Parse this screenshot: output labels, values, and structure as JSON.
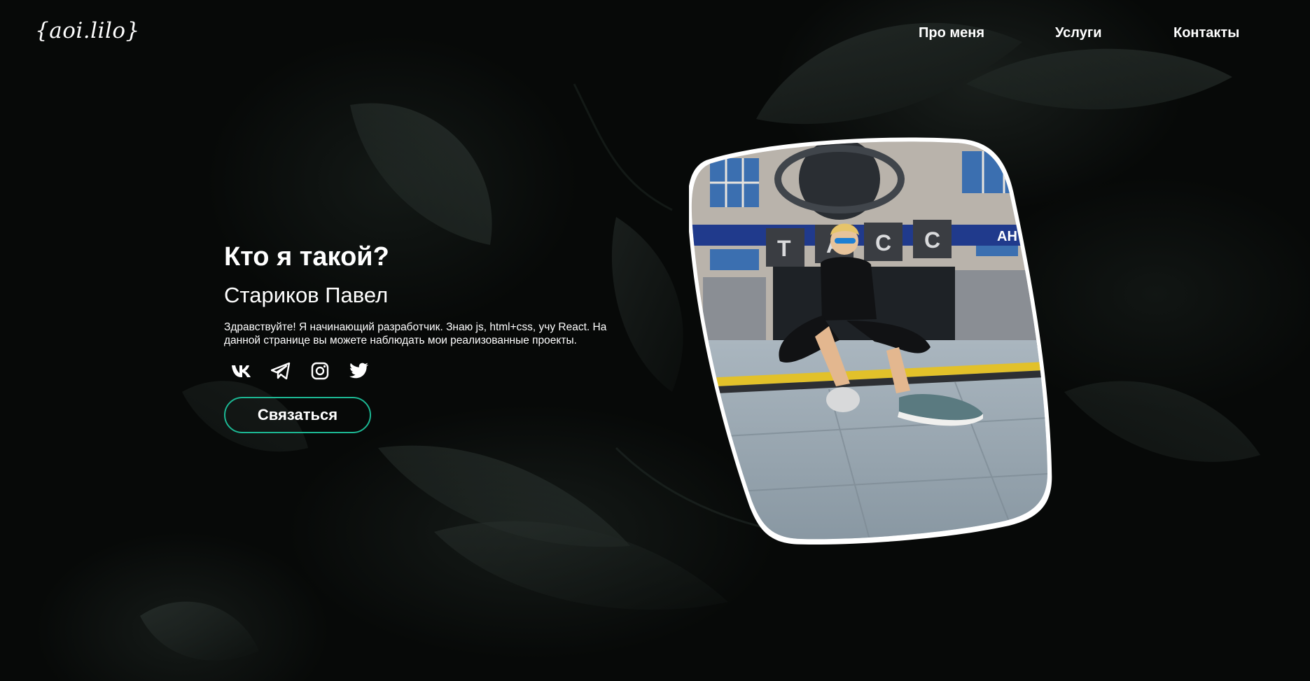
{
  "header": {
    "logo": "{aoi.lilo}",
    "nav": [
      {
        "label": "Про меня"
      },
      {
        "label": "Услуги"
      },
      {
        "label": "Контакты"
      }
    ]
  },
  "hero": {
    "title": "Кто я такой?",
    "name": "Стариков Павел",
    "description": "Здравствуйте! Я начинающий разработчик. Знаю js, html+css, учу React. На данной странице вы можете наблюдать мои реализованные проекты.",
    "socials": [
      {
        "icon": "vk-icon"
      },
      {
        "icon": "telegram-icon"
      },
      {
        "icon": "instagram-icon"
      },
      {
        "icon": "twitter-icon"
      }
    ],
    "button_label": "Связаться"
  },
  "photo": {
    "sign_letters": [
      "Т",
      "А",
      "С",
      "С"
    ],
    "ticker_text": "АН"
  },
  "colors": {
    "accent": "#1cb793",
    "background": "#070908",
    "text": "#ffffff"
  }
}
